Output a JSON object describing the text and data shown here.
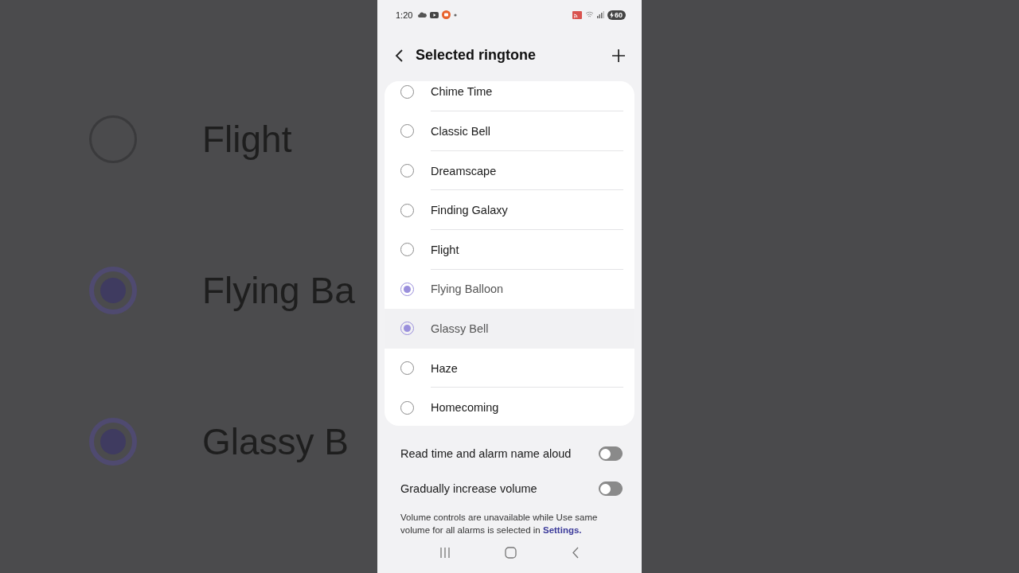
{
  "backdrop": {
    "items": [
      {
        "label": "Flight",
        "selected": false
      },
      {
        "label": "Flying Ba",
        "selected": true
      },
      {
        "label": "Glassy B",
        "selected": true
      }
    ]
  },
  "status_bar": {
    "time": "1:20",
    "battery": "60"
  },
  "header": {
    "title": "Selected ringtone"
  },
  "ringtones": [
    {
      "label": "Chime Time",
      "selected": false,
      "highlighted": false
    },
    {
      "label": "Classic Bell",
      "selected": false,
      "highlighted": false
    },
    {
      "label": "Dreamscape",
      "selected": false,
      "highlighted": false
    },
    {
      "label": "Finding Galaxy",
      "selected": false,
      "highlighted": false
    },
    {
      "label": "Flight",
      "selected": false,
      "highlighted": false
    },
    {
      "label": "Flying Balloon",
      "selected": true,
      "highlighted": false
    },
    {
      "label": "Glassy Bell",
      "selected": true,
      "highlighted": true
    },
    {
      "label": "Haze",
      "selected": false,
      "highlighted": false
    },
    {
      "label": "Homecoming",
      "selected": false,
      "highlighted": false
    }
  ],
  "options": [
    {
      "label": "Read time and alarm name aloud",
      "on": false
    },
    {
      "label": "Gradually increase volume",
      "on": false
    }
  ],
  "note": {
    "text": "Volume controls are unavailable while Use same volume for all alarms is selected in",
    "link": "Settings."
  }
}
